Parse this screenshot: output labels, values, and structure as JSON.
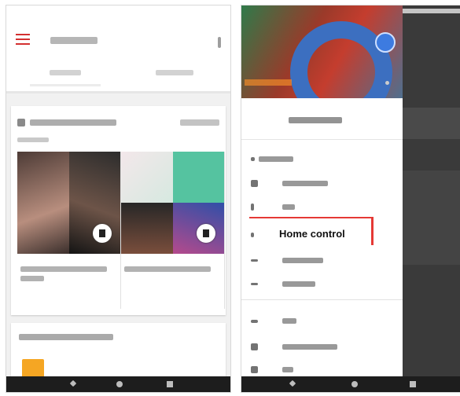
{
  "colors": {
    "accent": "#d32f2f",
    "highlight_box": "#e53935",
    "scrim": "#3a3a3a",
    "nav_bar": "#1d1d1d"
  },
  "left_screen": {
    "title": "",
    "tabs": [
      "",
      ""
    ],
    "card1": {
      "title": "",
      "action": "",
      "subtitle": "",
      "tiles": [
        {
          "caption": ""
        },
        {
          "caption": ""
        }
      ]
    },
    "card2": {
      "title": ""
    },
    "icons": {
      "menu": "hamburger-icon",
      "search": "more-icon",
      "play": "play-icon"
    }
  },
  "right_screen": {
    "account_name": "",
    "section_label": "",
    "menu_items": [
      {
        "label": "",
        "icon": "home-icon"
      },
      {
        "label": "",
        "icon": "info-icon"
      },
      {
        "label": "Home control",
        "icon": "lightbulb-icon",
        "highlighted": true
      },
      {
        "label": "",
        "icon": "music-icon"
      },
      {
        "label": "",
        "icon": "offers-icon"
      },
      {
        "label": "",
        "icon": "wifi-icon"
      },
      {
        "label": "",
        "icon": "devices-icon"
      },
      {
        "label": "",
        "icon": "video-icon"
      }
    ]
  }
}
